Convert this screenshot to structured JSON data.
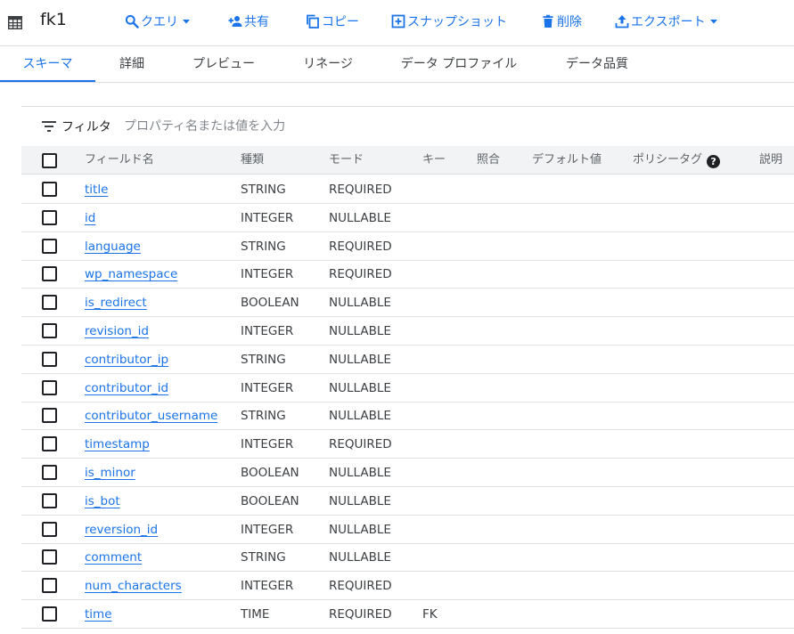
{
  "header": {
    "title": "fk1",
    "actions": [
      {
        "label": "クエリ",
        "icon": "search-icon",
        "dropdown": true
      },
      {
        "label": "共有",
        "icon": "person-add-icon",
        "dropdown": false
      },
      {
        "label": "コピー",
        "icon": "copy-icon",
        "dropdown": false
      },
      {
        "label": "スナップショット",
        "icon": "snapshot-icon",
        "dropdown": false
      },
      {
        "label": "削除",
        "icon": "trash-icon",
        "dropdown": false
      },
      {
        "label": "エクスポート",
        "icon": "upload-icon",
        "dropdown": true
      }
    ]
  },
  "tabs": [
    {
      "label": "スキーマ",
      "active": true
    },
    {
      "label": "詳細",
      "active": false
    },
    {
      "label": "プレビュー",
      "active": false
    },
    {
      "label": "リネージ",
      "active": false
    },
    {
      "label": "データ プロファイル",
      "active": false
    },
    {
      "label": "データ品質",
      "active": false
    }
  ],
  "filter": {
    "label": "フィルタ",
    "placeholder": "プロパティ名または値を入力"
  },
  "table": {
    "columns": {
      "name": "フィールド名",
      "type": "種類",
      "mode": "モード",
      "key": "キー",
      "collation": "照合",
      "default": "デフォルト値",
      "policy": "ポリシータグ",
      "policy_help": "?",
      "description": "説明"
    },
    "rows": [
      {
        "name": "title",
        "type": "STRING",
        "mode": "REQUIRED",
        "key": ""
      },
      {
        "name": "id",
        "type": "INTEGER",
        "mode": "NULLABLE",
        "key": ""
      },
      {
        "name": "language",
        "type": "STRING",
        "mode": "REQUIRED",
        "key": ""
      },
      {
        "name": "wp_namespace",
        "type": "INTEGER",
        "mode": "REQUIRED",
        "key": ""
      },
      {
        "name": "is_redirect",
        "type": "BOOLEAN",
        "mode": "NULLABLE",
        "key": ""
      },
      {
        "name": "revision_id",
        "type": "INTEGER",
        "mode": "NULLABLE",
        "key": ""
      },
      {
        "name": "contributor_ip",
        "type": "STRING",
        "mode": "NULLABLE",
        "key": ""
      },
      {
        "name": "contributor_id",
        "type": "INTEGER",
        "mode": "NULLABLE",
        "key": ""
      },
      {
        "name": "contributor_username",
        "type": "STRING",
        "mode": "NULLABLE",
        "key": ""
      },
      {
        "name": "timestamp",
        "type": "INTEGER",
        "mode": "REQUIRED",
        "key": ""
      },
      {
        "name": "is_minor",
        "type": "BOOLEAN",
        "mode": "NULLABLE",
        "key": ""
      },
      {
        "name": "is_bot",
        "type": "BOOLEAN",
        "mode": "NULLABLE",
        "key": ""
      },
      {
        "name": "reversion_id",
        "type": "INTEGER",
        "mode": "NULLABLE",
        "key": ""
      },
      {
        "name": "comment",
        "type": "STRING",
        "mode": "NULLABLE",
        "key": ""
      },
      {
        "name": "num_characters",
        "type": "INTEGER",
        "mode": "REQUIRED",
        "key": ""
      },
      {
        "name": "time",
        "type": "TIME",
        "mode": "REQUIRED",
        "key": "FK"
      }
    ]
  },
  "colors": {
    "accent": "#1a73e8",
    "header_bg": "#f1f3f4",
    "divider": "#dadce0"
  }
}
